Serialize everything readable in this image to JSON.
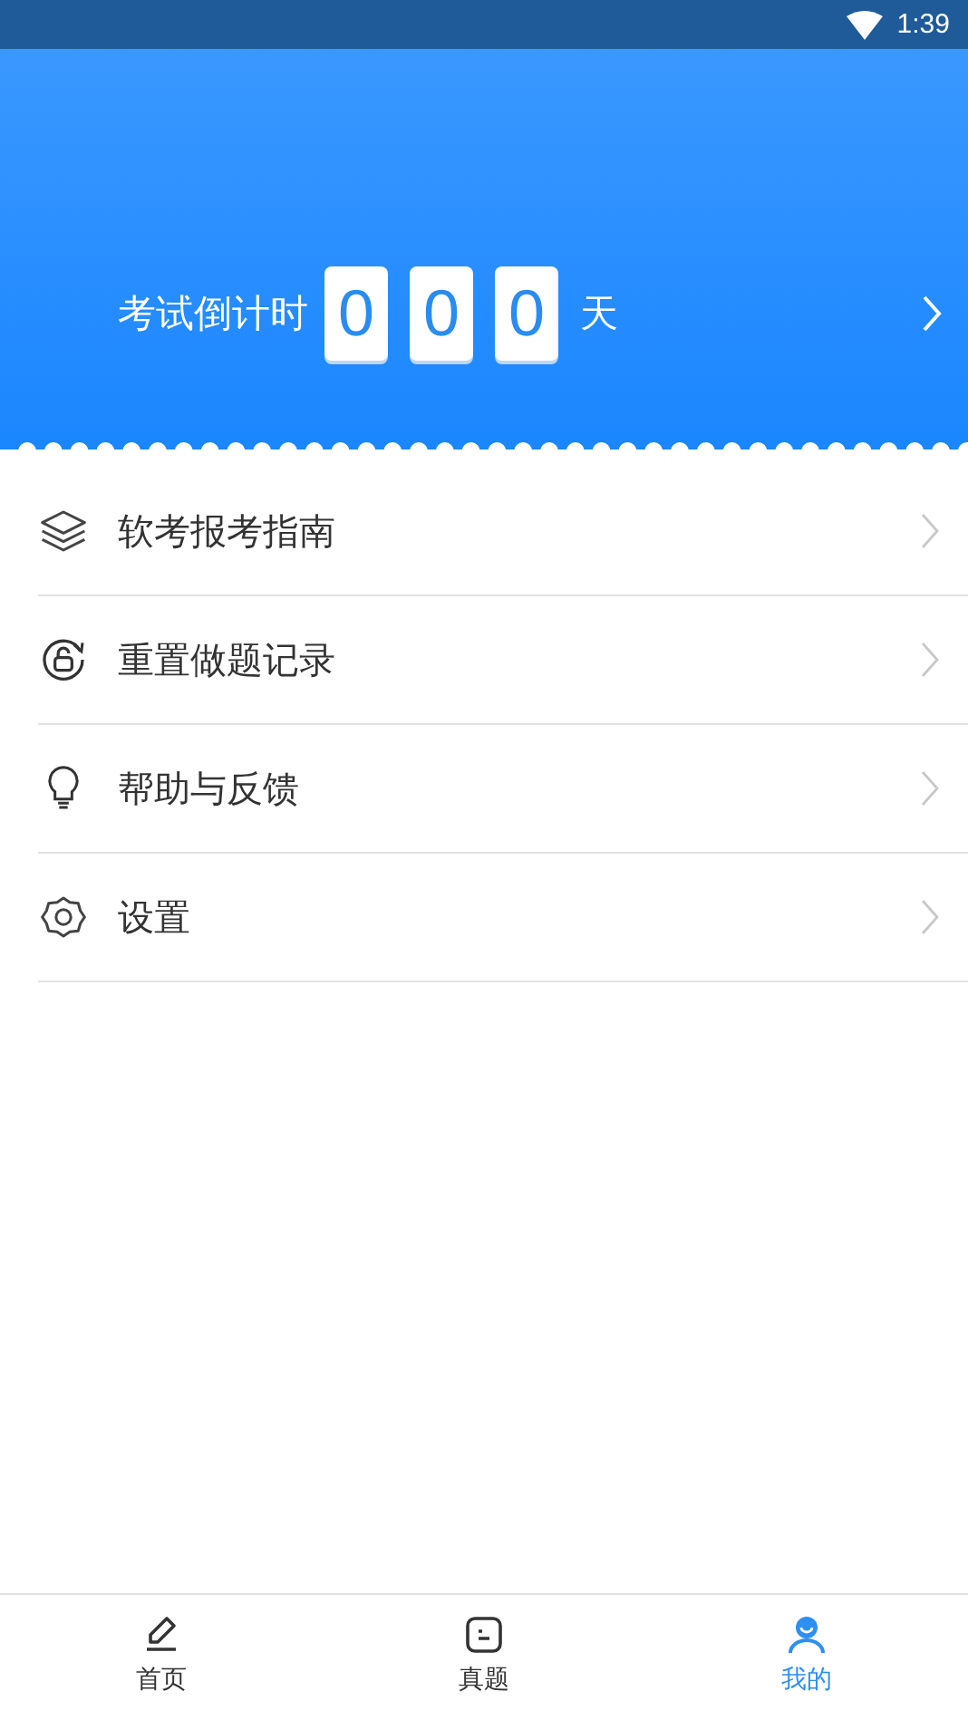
{
  "status_bar": {
    "time": "1:39"
  },
  "countdown": {
    "label": "考试倒计时",
    "digits": [
      "0",
      "0",
      "0"
    ],
    "unit": "天"
  },
  "menu": [
    {
      "label": "软考报考指南"
    },
    {
      "label": "重置做题记录"
    },
    {
      "label": "帮助与反馈"
    },
    {
      "label": "设置"
    }
  ],
  "bottom_nav": [
    {
      "label": "首页",
      "selected": false
    },
    {
      "label": "真题",
      "selected": false
    },
    {
      "label": "我的",
      "selected": true
    }
  ]
}
